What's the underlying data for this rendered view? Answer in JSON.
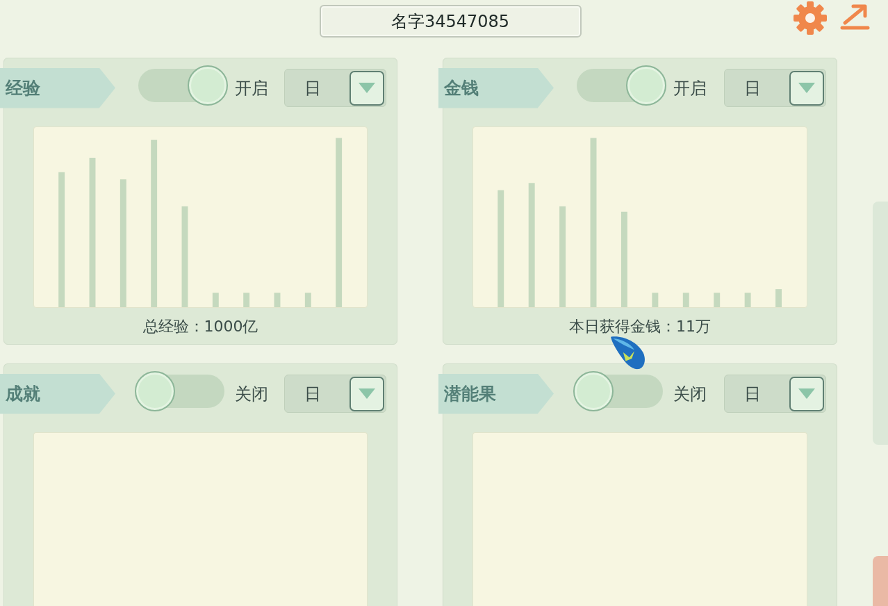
{
  "header": {
    "title": "名字34547085"
  },
  "panels": [
    {
      "title": "经验",
      "toggle": {
        "on": true,
        "label": "开启"
      },
      "period": {
        "value": "日"
      },
      "summary": "总经验：1000亿"
    },
    {
      "title": "金钱",
      "toggle": {
        "on": true,
        "label": "开启"
      },
      "period": {
        "value": "日"
      },
      "summary": "本日获得金钱：11万"
    },
    {
      "title": "成就",
      "toggle": {
        "on": false,
        "label": "关闭"
      },
      "period": {
        "value": "日"
      }
    },
    {
      "title": "潜能果",
      "toggle": {
        "on": false,
        "label": "关闭"
      },
      "period": {
        "value": "日"
      }
    }
  ]
}
